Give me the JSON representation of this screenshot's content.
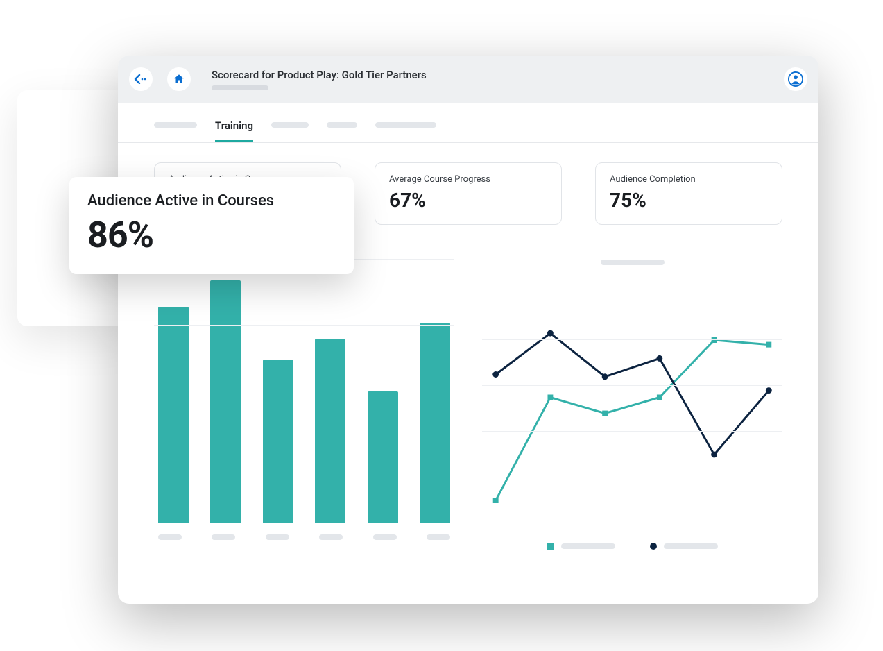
{
  "header": {
    "title": "Scorecard for Product Play: Gold Tier Partners"
  },
  "tabs": {
    "active_label": "Training"
  },
  "stats": {
    "audience_active": {
      "label": "Audience Active in Courses",
      "value": "86%"
    },
    "avg_progress": {
      "label": "Average Course Progress",
      "value": "67%"
    },
    "completion": {
      "label": "Audience Completion",
      "value": "75%"
    }
  },
  "colors": {
    "teal": "#33b1aa",
    "navy": "#0c2340",
    "accent": "#0a6ed1"
  },
  "chart_data": [
    {
      "type": "bar",
      "title": "",
      "categories": [
        "",
        "",
        "",
        "",
        "",
        ""
      ],
      "values": [
        82,
        92,
        62,
        70,
        50,
        76
      ],
      "ylim": [
        0,
        100
      ],
      "color": "#33b1aa"
    },
    {
      "type": "line",
      "title": "",
      "x": [
        0,
        1,
        2,
        3,
        4,
        5
      ],
      "series": [
        {
          "name": "",
          "values": [
            10,
            55,
            48,
            55,
            80,
            78
          ],
          "color": "#33b1aa",
          "marker": "square"
        },
        {
          "name": "",
          "values": [
            65,
            83,
            64,
            72,
            30,
            58
          ],
          "color": "#0c2340",
          "marker": "circle"
        }
      ],
      "ylim": [
        0,
        100
      ]
    }
  ]
}
